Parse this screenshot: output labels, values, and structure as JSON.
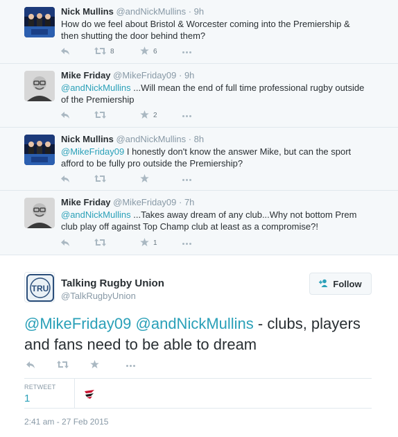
{
  "thread": [
    {
      "name": "Nick Mullins",
      "handle": "@andNickMullins",
      "time": "9h",
      "text_parts": [
        {
          "text": "How do we feel about Bristol & Worcester coming into the Premiership & then shutting the door behind them?",
          "mention": false
        }
      ],
      "retweets": "8",
      "favorites": "6",
      "avatar_icon": "tv-studio-avatar"
    },
    {
      "name": "Mike Friday",
      "handle": "@MikeFriday09",
      "time": "9h",
      "text_parts": [
        {
          "text": "@andNickMullins",
          "mention": true
        },
        {
          "text": " ...Will mean the end of full time professional rugby outside of the Premiership",
          "mention": false
        }
      ],
      "retweets": "",
      "favorites": "2",
      "avatar_icon": "man-glasses-avatar"
    },
    {
      "name": "Nick Mullins",
      "handle": "@andNickMullins",
      "time": "8h",
      "text_parts": [
        {
          "text": "@MikeFriday09",
          "mention": true
        },
        {
          "text": " I honestly don't know the answer Mike, but can the sport afford to be fully pro outside the Premiership?",
          "mention": false
        }
      ],
      "retweets": "",
      "favorites": "",
      "avatar_icon": "tv-studio-avatar"
    },
    {
      "name": "Mike Friday",
      "handle": "@MikeFriday09",
      "time": "7h",
      "text_parts": [
        {
          "text": "@andNickMullins",
          "mention": true
        },
        {
          "text": " ...Takes away dream of any club...Why not bottom Prem club play off against Top Champ club at least as a compromise?!",
          "mention": false
        }
      ],
      "retweets": "",
      "favorites": "1",
      "avatar_icon": "man-glasses-avatar"
    }
  ],
  "main": {
    "name": "Talking Rugby Union",
    "handle": "@TalkRugbyUnion",
    "follow_label": "Follow",
    "logo_text": "TRU",
    "mention1": "@MikeFriday09",
    "mention2": "@andNickMullins",
    "text_rest": " - clubs, players and fans need to be able to dream",
    "retweet_label": "RETWEET",
    "retweet_count": "1",
    "timestamp": "2:41 am - 27 Feb 2015"
  },
  "icons": {
    "reply": "reply-icon",
    "retweet": "retweet-icon",
    "favorite": "star-icon",
    "more": "more-dots-icon"
  },
  "colors": {
    "accent": "#2aa0b8",
    "muted": "#8899a6",
    "thread_bg": "#f5f8fa",
    "border": "#e1e8ed"
  }
}
